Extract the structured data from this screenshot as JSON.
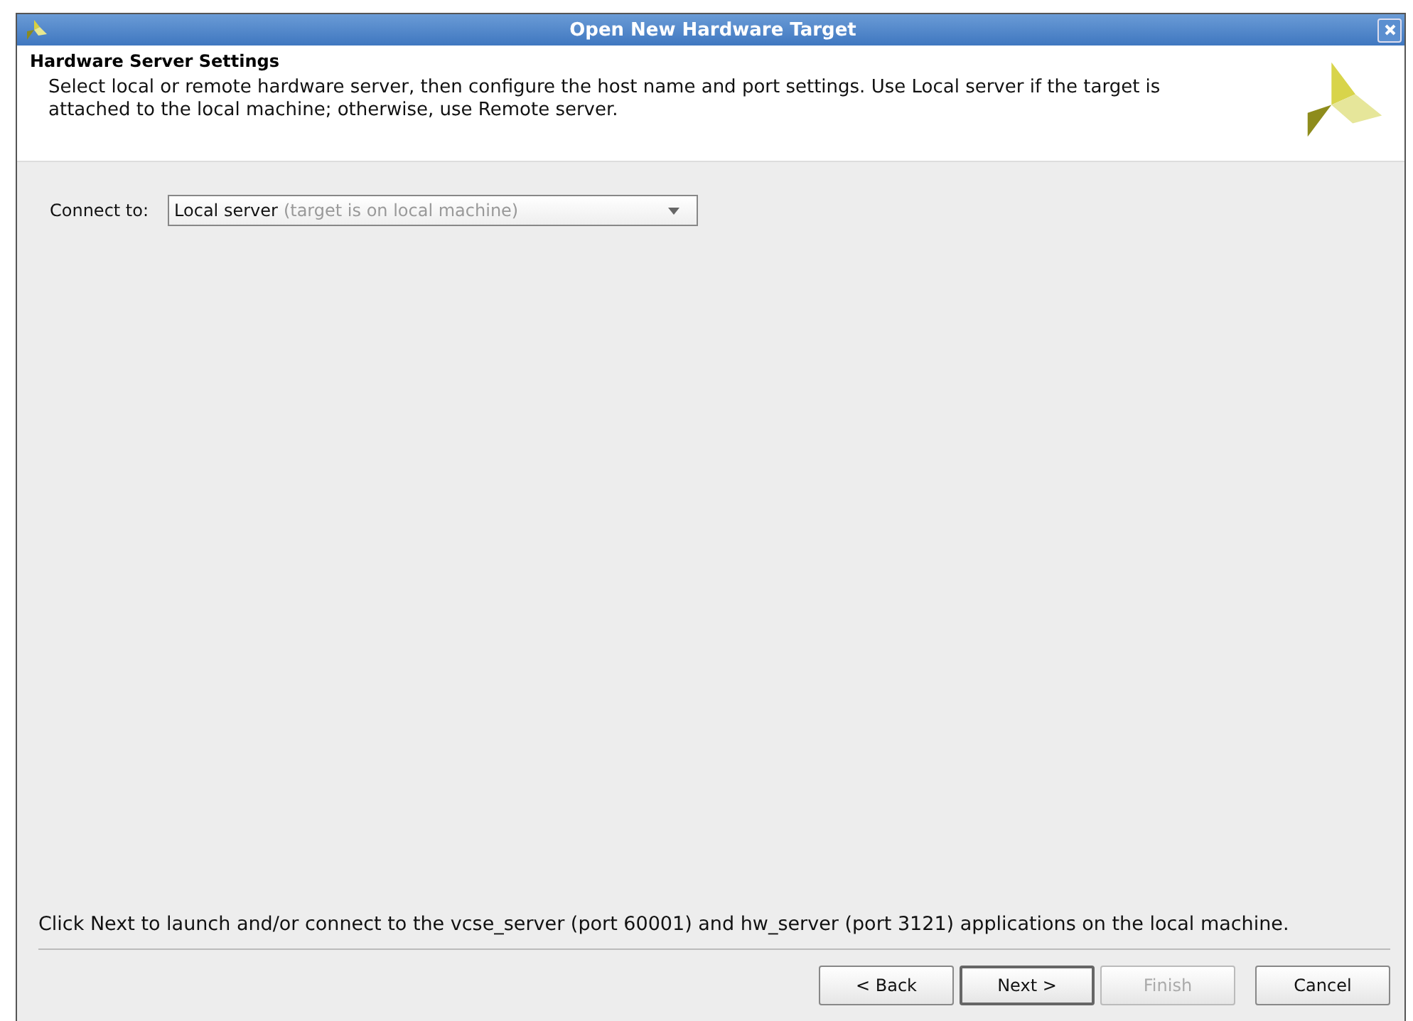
{
  "window": {
    "title": "Open New Hardware Target"
  },
  "header": {
    "title": "Hardware Server Settings",
    "description": "Select local or remote hardware server, then configure the host name and port settings. Use Local server if the target is attached to the local machine; otherwise, use Remote server."
  },
  "connect": {
    "label": "Connect to:",
    "value": "Local server",
    "hint": "(target is on local machine)"
  },
  "info": "Click Next to launch and/or connect to the vcse_server (port 60001) and hw_server (port 3121) applications on the local machine.",
  "buttons": [
    {
      "label": "< Back",
      "disabled": false,
      "default": false
    },
    {
      "label": "Next >",
      "disabled": false,
      "default": true
    },
    {
      "label": "Finish",
      "disabled": true,
      "default": false
    },
    {
      "label": "Cancel",
      "disabled": false,
      "default": false
    }
  ]
}
